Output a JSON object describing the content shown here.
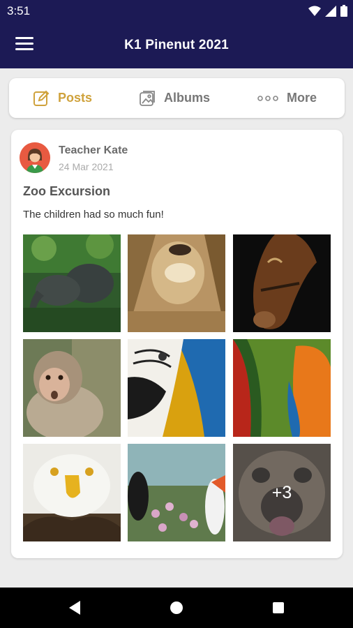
{
  "status_bar": {
    "time": "3:51"
  },
  "app_bar": {
    "title": "K1 Pinenut 2021"
  },
  "tabs": [
    {
      "label": "Posts",
      "icon": "edit-icon",
      "active": true
    },
    {
      "label": "Albums",
      "icon": "image-icon",
      "active": false
    },
    {
      "label": "More",
      "icon": "more-dots-icon",
      "active": false
    }
  ],
  "post": {
    "author": "Teacher Kate",
    "date": "24 Mar 2021",
    "title": "Zoo Excursion",
    "body": "The children had so much fun!",
    "photos": [
      {
        "subject": "elephants"
      },
      {
        "subject": "lion"
      },
      {
        "subject": "horse"
      },
      {
        "subject": "monkey"
      },
      {
        "subject": "macaw"
      },
      {
        "subject": "parrots"
      },
      {
        "subject": "eagle"
      },
      {
        "subject": "puffins"
      },
      {
        "subject": "pug"
      }
    ],
    "more_count": "+3"
  },
  "colors": {
    "primary": "#1c1a55",
    "accent": "#cfa23c",
    "background": "#ececec"
  }
}
